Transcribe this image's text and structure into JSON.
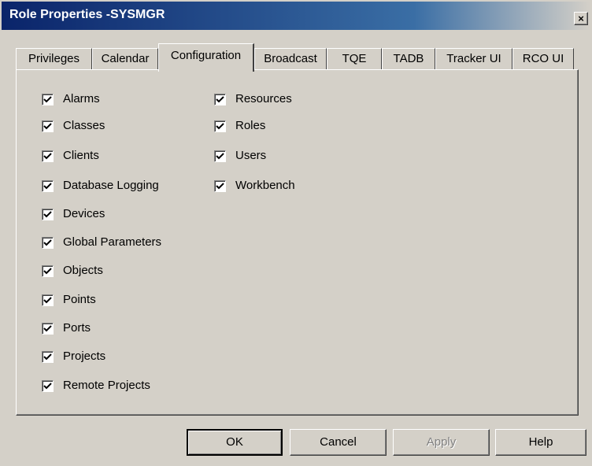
{
  "window": {
    "title": "Role Properties -SYSMGR",
    "close_label": "×"
  },
  "tabs": [
    {
      "label": "Privileges",
      "active": false
    },
    {
      "label": "Calendar",
      "active": false
    },
    {
      "label": "Configuration",
      "active": true
    },
    {
      "label": "Broadcast",
      "active": false
    },
    {
      "label": "TQE",
      "active": false
    },
    {
      "label": "TADB",
      "active": false
    },
    {
      "label": "Tracker UI",
      "active": false
    },
    {
      "label": "RCO UI",
      "active": false
    }
  ],
  "checkboxes": {
    "left": [
      {
        "label": "Alarms",
        "checked": true
      },
      {
        "label": "Classes",
        "checked": true
      },
      {
        "label": "Clients",
        "checked": true
      },
      {
        "label": "Database Logging",
        "checked": true
      },
      {
        "label": "Devices",
        "checked": true
      },
      {
        "label": "Global Parameters",
        "checked": true
      },
      {
        "label": "Objects",
        "checked": true
      },
      {
        "label": "Points",
        "checked": true
      },
      {
        "label": "Ports",
        "checked": true
      },
      {
        "label": "Projects",
        "checked": true
      },
      {
        "label": "Remote Projects",
        "checked": true
      }
    ],
    "right": [
      {
        "label": "Resources",
        "checked": true
      },
      {
        "label": "Roles",
        "checked": true
      },
      {
        "label": "Users",
        "checked": true
      },
      {
        "label": "Workbench",
        "checked": true
      }
    ]
  },
  "buttons": {
    "ok": "OK",
    "cancel": "Cancel",
    "apply": "Apply",
    "help": "Help"
  }
}
